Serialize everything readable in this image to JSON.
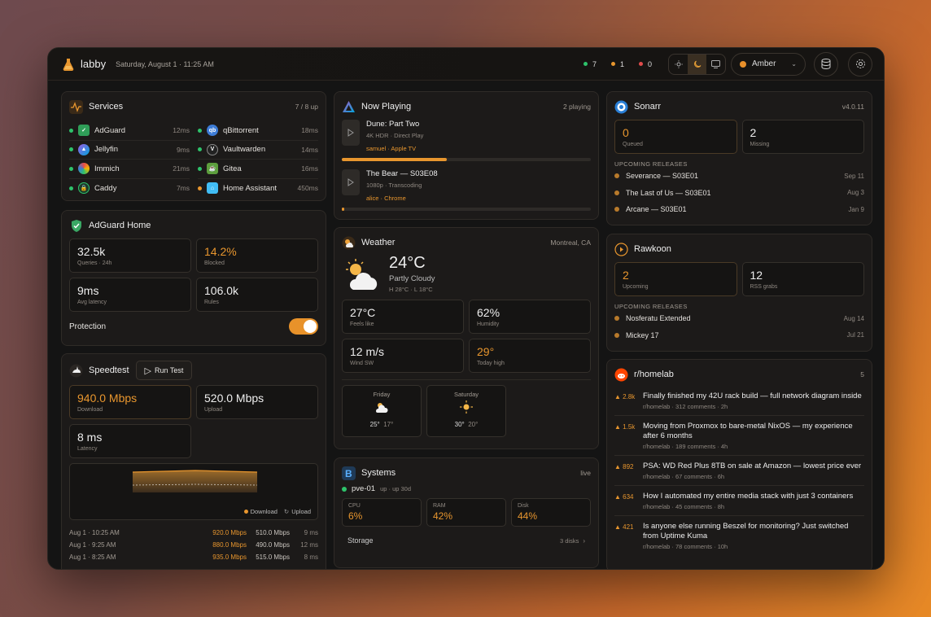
{
  "topbar": {
    "app_name": "labby",
    "date": "Saturday, August 1 · 11:25 AM",
    "stats": [
      {
        "value": "7",
        "color": "#2ec36b"
      },
      {
        "value": "1",
        "color": "#e8962e"
      },
      {
        "value": "0",
        "color": "#e04b4b"
      }
    ],
    "theme_options": [
      "sun-icon",
      "moon-icon",
      "monitor-icon"
    ],
    "accent_label": "Amber"
  },
  "services": {
    "title": "Services",
    "meta": "7 / 8 up",
    "items": [
      {
        "name": "AdGuard",
        "ms": "12ms",
        "status": "#2ec36b"
      },
      {
        "name": "qBittorrent",
        "ms": "18ms",
        "status": "#2ec36b"
      },
      {
        "name": "Jellyfin",
        "ms": "9ms",
        "status": "#2ec36b"
      },
      {
        "name": "Vaultwarden",
        "ms": "14ms",
        "status": "#2ec36b"
      },
      {
        "name": "Immich",
        "ms": "21ms",
        "status": "#2ec36b"
      },
      {
        "name": "Gitea",
        "ms": "16ms",
        "status": "#2ec36b"
      },
      {
        "name": "Caddy",
        "ms": "7ms",
        "status": "#2ec36b"
      },
      {
        "name": "Home Assistant",
        "ms": "450ms",
        "status": "#e8962e"
      }
    ]
  },
  "adguard": {
    "title": "AdGuard Home",
    "tiles": [
      {
        "value": "32.5k",
        "label": "Queries · 24h"
      },
      {
        "value": "14.2%",
        "label": "Blocked"
      },
      {
        "value": "9ms",
        "label": "Avg latency"
      },
      {
        "value": "106.0k",
        "label": "Rules"
      }
    ],
    "protection_label": "Protection"
  },
  "speedtest": {
    "title": "Speedtest",
    "run_label": "Run Test",
    "tiles": [
      {
        "value": "940.0 Mbps",
        "label": "Download"
      },
      {
        "value": "520.0 Mbps",
        "label": "Upload"
      },
      {
        "value": "8 ms",
        "label": "Latency"
      }
    ],
    "legend_download": "Download",
    "legend_upload": "Upload",
    "history": [
      {
        "time": "Aug 1 · 10:25 AM",
        "down": "920.0 Mbps",
        "up": "510.0 Mbps",
        "lat": "9 ms"
      },
      {
        "time": "Aug 1 · 9:25 AM",
        "down": "880.0 Mbps",
        "up": "490.0 Mbps",
        "lat": "12 ms"
      },
      {
        "time": "Aug 1 · 8:25 AM",
        "down": "935.0 Mbps",
        "up": "515.0 Mbps",
        "lat": "8 ms"
      }
    ]
  },
  "nowplaying": {
    "title": "Now Playing",
    "meta": "2 playing",
    "items": [
      {
        "title": "Dune: Part Two",
        "sub": "4K HDR · Direct Play",
        "user": "samuel · Apple TV",
        "progress": 0.42
      },
      {
        "title": "The Bear — S03E08",
        "sub": "1080p · Transcoding",
        "user": "alice · Chrome",
        "progress": 0.01
      }
    ]
  },
  "weather": {
    "title": "Weather",
    "location": "Montreal, CA",
    "temp": "24°C",
    "condition": "Partly Cloudy",
    "hilo": "H 28°C · L 18°C",
    "tiles": [
      {
        "value": "27°C",
        "label": "Feels like"
      },
      {
        "value": "62%",
        "label": "Humidity"
      },
      {
        "value": "12 m/s",
        "label": "Wind SW"
      },
      {
        "value": "29°",
        "label": "Today high"
      }
    ],
    "forecast": [
      {
        "day": "Friday",
        "hi": "25°",
        "lo": "17°",
        "icon": "cloud-icon"
      },
      {
        "day": "Saturday",
        "hi": "30°",
        "lo": "20°",
        "icon": "sun-icon"
      }
    ]
  },
  "systems": {
    "title": "Systems",
    "meta": "live",
    "host": "pve-01",
    "uptime": "up · up 30d",
    "tiles": [
      {
        "label": "CPU",
        "value": "6%"
      },
      {
        "label": "RAM",
        "value": "42%"
      },
      {
        "label": "Disk",
        "value": "44%"
      }
    ],
    "storage_label": "Storage",
    "storage_meta": "3 disks"
  },
  "sonarr": {
    "title": "Sonarr",
    "meta": "v4.0.11",
    "tiles": [
      {
        "value": "0",
        "label": "Queued"
      },
      {
        "value": "2",
        "label": "Missing"
      }
    ],
    "section": "UPCOMING RELEASES",
    "releases": [
      {
        "title": "Severance — S03E01",
        "date": "Sep 11"
      },
      {
        "title": "The Last of Us — S03E01",
        "date": "Aug 3"
      },
      {
        "title": "Arcane — S03E01",
        "date": "Jan 9"
      }
    ]
  },
  "rawkoon": {
    "title": "Rawkoon",
    "tiles": [
      {
        "value": "2",
        "label": "Upcoming"
      },
      {
        "value": "12",
        "label": "RSS grabs"
      }
    ],
    "section": "UPCOMING RELEASES",
    "releases": [
      {
        "title": "Nosferatu Extended",
        "date": "Aug 14"
      },
      {
        "title": "Mickey 17",
        "date": "Jul 21"
      }
    ]
  },
  "reddit": {
    "title": "r/homelab",
    "meta": "5",
    "posts": [
      {
        "score": "▲ 2.8k",
        "title": "Finally finished my 42U rack build — full network diagram inside",
        "meta": "r/homelab · 312 comments · 2h"
      },
      {
        "score": "▲ 1.5k",
        "title": "Moving from Proxmox to bare-metal NixOS — my experience after 6 months",
        "meta": "r/homelab · 189 comments · 4h"
      },
      {
        "score": "▲ 892",
        "title": "PSA: WD Red Plus 8TB on sale at Amazon — lowest price ever",
        "meta": "r/homelab · 67 comments · 6h"
      },
      {
        "score": "▲ 634",
        "title": "How I automated my entire media stack with just 3 containers",
        "meta": "r/homelab · 45 comments · 8h"
      },
      {
        "score": "▲ 421",
        "title": "Is anyone else running Beszel for monitoring? Just switched from Uptime Kuma",
        "meta": "r/homelab · 78 comments · 10h"
      }
    ]
  }
}
